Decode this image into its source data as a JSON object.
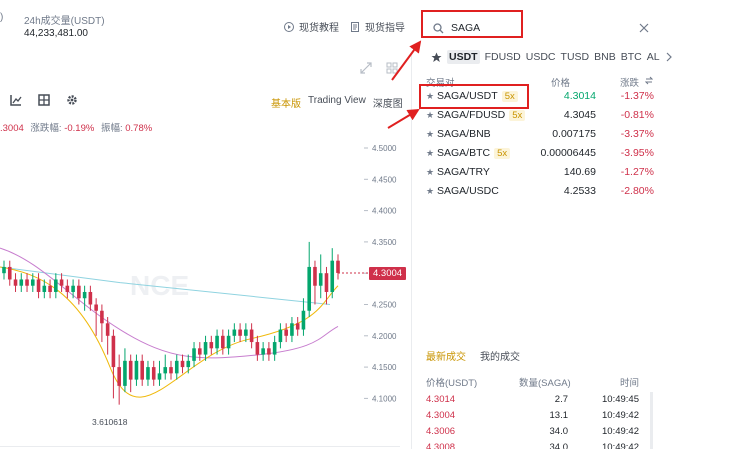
{
  "header": {
    "truncated_prev": ")",
    "volume_label": "24h成交量(USDT)",
    "volume_value": "44,233,481.00",
    "link1": "现货教程",
    "link2": "现货指导"
  },
  "chart": {
    "info_price": ".3004",
    "change_label": "涨跌幅:",
    "change_value": "-0.19%",
    "amp_label": "振幅:",
    "amp_value": "0.78%",
    "views": [
      "基本版",
      "Trading View",
      "深度图"
    ],
    "current_price": "4.3004",
    "low_marker": "3.610618",
    "watermark": "NCE",
    "y_ticks": [
      "4.5000",
      "4.4500",
      "4.4000",
      "4.3500",
      "4.3000",
      "4.2500",
      "4.2000",
      "4.1500",
      "4.1000"
    ]
  },
  "chart_data": {
    "type": "candlestick",
    "title": "",
    "ylim": [
      4.08,
      4.53
    ],
    "current_price": 4.3004,
    "y_ticks": [
      4.5,
      4.45,
      4.4,
      4.35,
      4.3,
      4.25,
      4.2,
      4.15,
      4.1
    ],
    "candles": [
      [
        4.3,
        4.31,
        4.32,
        4.29
      ],
      [
        4.31,
        4.29,
        4.32,
        4.28
      ],
      [
        4.29,
        4.28,
        4.3,
        4.27
      ],
      [
        4.28,
        4.29,
        4.3,
        4.27
      ],
      [
        4.29,
        4.28,
        4.3,
        4.27
      ],
      [
        4.28,
        4.29,
        4.3,
        4.27
      ],
      [
        4.29,
        4.27,
        4.3,
        4.26
      ],
      [
        4.27,
        4.28,
        4.29,
        4.26
      ],
      [
        4.28,
        4.27,
        4.29,
        4.26
      ],
      [
        4.27,
        4.29,
        4.3,
        4.26
      ],
      [
        4.29,
        4.28,
        4.3,
        4.27
      ],
      [
        4.28,
        4.27,
        4.29,
        4.26
      ],
      [
        4.27,
        4.28,
        4.29,
        4.26
      ],
      [
        4.28,
        4.26,
        4.29,
        4.25
      ],
      [
        4.26,
        4.27,
        4.28,
        4.24
      ],
      [
        4.27,
        4.25,
        4.28,
        4.24
      ],
      [
        4.25,
        4.24,
        4.26,
        4.2
      ],
      [
        4.24,
        4.22,
        4.25,
        4.19
      ],
      [
        4.22,
        4.2,
        4.23,
        4.17
      ],
      [
        4.2,
        4.15,
        4.21,
        4.1
      ],
      [
        4.15,
        4.12,
        4.17,
        4.09
      ],
      [
        4.12,
        4.16,
        4.18,
        4.11
      ],
      [
        4.16,
        4.13,
        4.17,
        4.11
      ],
      [
        4.13,
        4.16,
        4.17,
        4.12
      ],
      [
        4.16,
        4.13,
        4.17,
        4.12
      ],
      [
        4.13,
        4.15,
        4.16,
        4.12
      ],
      [
        4.15,
        4.13,
        4.16,
        4.12
      ],
      [
        4.13,
        4.14,
        4.16,
        4.12
      ],
      [
        4.14,
        4.15,
        4.17,
        4.13
      ],
      [
        4.15,
        4.14,
        4.16,
        4.13
      ],
      [
        4.14,
        4.16,
        4.17,
        4.13
      ],
      [
        4.16,
        4.15,
        4.17,
        4.14
      ],
      [
        4.15,
        4.16,
        4.17,
        4.14
      ],
      [
        4.16,
        4.18,
        4.19,
        4.15
      ],
      [
        4.18,
        4.17,
        4.19,
        4.16
      ],
      [
        4.17,
        4.19,
        4.2,
        4.16
      ],
      [
        4.19,
        4.18,
        4.2,
        4.17
      ],
      [
        4.18,
        4.2,
        4.21,
        4.17
      ],
      [
        4.2,
        4.18,
        4.21,
        4.17
      ],
      [
        4.18,
        4.2,
        4.21,
        4.17
      ],
      [
        4.2,
        4.21,
        4.22,
        4.19
      ],
      [
        4.21,
        4.2,
        4.22,
        4.19
      ],
      [
        4.2,
        4.21,
        4.22,
        4.19
      ],
      [
        4.21,
        4.19,
        4.22,
        4.18
      ],
      [
        4.19,
        4.17,
        4.2,
        4.16
      ],
      [
        4.17,
        4.18,
        4.19,
        4.16
      ],
      [
        4.18,
        4.17,
        4.19,
        4.16
      ],
      [
        4.17,
        4.19,
        4.2,
        4.16
      ],
      [
        4.19,
        4.21,
        4.22,
        4.18
      ],
      [
        4.21,
        4.2,
        4.22,
        4.19
      ],
      [
        4.2,
        4.22,
        4.23,
        4.19
      ],
      [
        4.22,
        4.21,
        4.23,
        4.2
      ],
      [
        4.21,
        4.24,
        4.26,
        4.2
      ],
      [
        4.24,
        4.31,
        4.35,
        4.23
      ],
      [
        4.31,
        4.28,
        4.32,
        4.25
      ],
      [
        4.28,
        4.3,
        4.33,
        4.26
      ],
      [
        4.3,
        4.27,
        4.31,
        4.25
      ],
      [
        4.27,
        4.32,
        4.34,
        4.26
      ],
      [
        4.32,
        4.3004,
        4.33,
        4.29
      ]
    ]
  },
  "search": {
    "value": "SAGA"
  },
  "quote_tabs": [
    "USDT",
    "FDUSD",
    "USDC",
    "TUSD",
    "BNB",
    "BTC",
    "AL"
  ],
  "list_header": {
    "pair": "交易对",
    "price": "价格",
    "change": "涨跌"
  },
  "pairs": [
    {
      "pair": "SAGA/USDT",
      "lev": "5x",
      "price": "4.3014",
      "change": "-1.37%"
    },
    {
      "pair": "SAGA/FDUSD",
      "lev": "5x",
      "price": "4.3045",
      "change": "-0.81%"
    },
    {
      "pair": "SAGA/BNB",
      "lev": "",
      "price": "0.007175",
      "change": "-3.37%"
    },
    {
      "pair": "SAGA/BTC",
      "lev": "5x",
      "price": "0.00006445",
      "change": "-3.95%"
    },
    {
      "pair": "SAGA/TRY",
      "lev": "",
      "price": "140.69",
      "change": "-1.27%"
    },
    {
      "pair": "SAGA/USDC",
      "lev": "",
      "price": "4.2533",
      "change": "-2.80%"
    }
  ],
  "trades_tabs": [
    "最新成交",
    "我的成交"
  ],
  "trades_header": {
    "price": "价格(USDT)",
    "qty": "数量(SAGA)",
    "time": "时间"
  },
  "trades": [
    {
      "price": "4.3014",
      "qty": "2.7",
      "time": "10:49:45"
    },
    {
      "price": "4.3004",
      "qty": "13.1",
      "time": "10:49:42"
    },
    {
      "price": "4.3006",
      "qty": "34.0",
      "time": "10:49:42"
    },
    {
      "price": "4.3008",
      "qty": "34.0",
      "time": "10:49:42"
    }
  ],
  "colors": {
    "up": "#03a66d",
    "down": "#cf304a",
    "accent": "#c99400",
    "annotation": "#e02020"
  }
}
